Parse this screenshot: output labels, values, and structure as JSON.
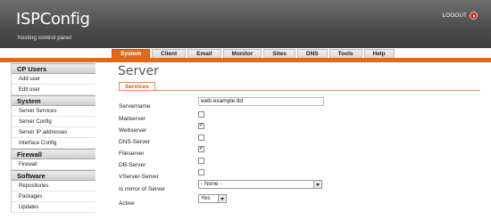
{
  "header": {
    "logo": "ISPConfig",
    "tagline": "hosting control panel",
    "logout_label": "LOGOUT"
  },
  "tabs": [
    {
      "label": "System",
      "active": true
    },
    {
      "label": "Client",
      "active": false
    },
    {
      "label": "Email",
      "active": false
    },
    {
      "label": "Monitor",
      "active": false
    },
    {
      "label": "Sites",
      "active": false
    },
    {
      "label": "DNS",
      "active": false
    },
    {
      "label": "Tools",
      "active": false
    },
    {
      "label": "Help",
      "active": false
    }
  ],
  "sidebar": [
    {
      "heading": "CP Users",
      "items": [
        "Add user",
        "Edit user"
      ]
    },
    {
      "heading": "System",
      "items": [
        "Server Services",
        "Server Config",
        "Server IP addresses",
        "Interface Config"
      ]
    },
    {
      "heading": "Firewall",
      "items": [
        "Firewall"
      ]
    },
    {
      "heading": "Software",
      "items": [
        "Repositories",
        "Packages",
        "Updates"
      ]
    }
  ],
  "main": {
    "title": "Server",
    "subtab": "Services",
    "fields": {
      "servername": {
        "label": "Servername",
        "value": "web.example.tld"
      },
      "mailserver": {
        "label": "Mailserver",
        "checked": false
      },
      "webserver": {
        "label": "Webserver",
        "checked": true
      },
      "dnsserver": {
        "label": "DNS-Server",
        "checked": false
      },
      "fileserver": {
        "label": "Fileserver",
        "checked": true
      },
      "dbserver": {
        "label": "DB-Server",
        "checked": false
      },
      "vserver": {
        "label": "VServer-Server",
        "checked": false
      },
      "mirror": {
        "label": "Is mirror of Server",
        "value": "- None -"
      },
      "active": {
        "label": "Active",
        "value": "Yes"
      }
    }
  },
  "colors": {
    "accent": "#e06a1c",
    "header": "#4c4c4c"
  }
}
